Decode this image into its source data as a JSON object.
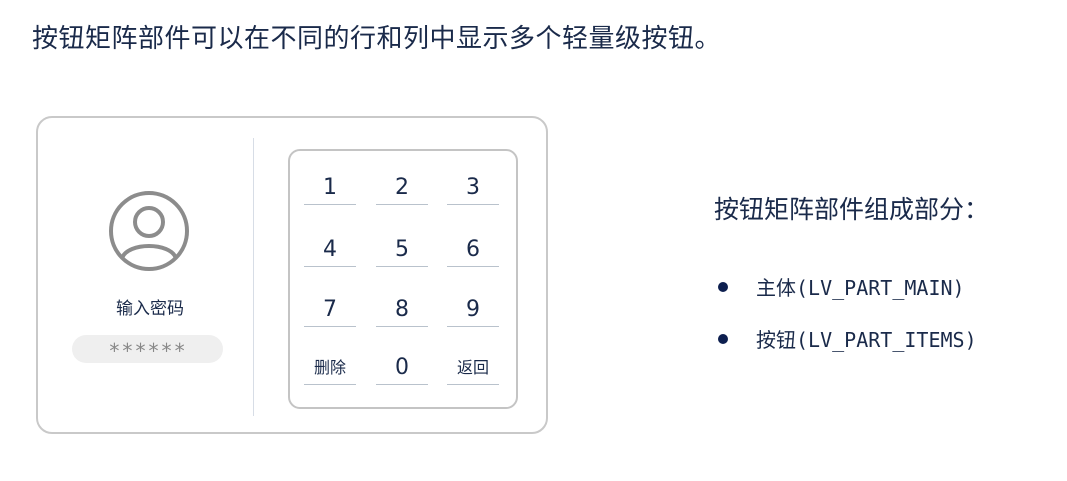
{
  "headline": "按钮矩阵部件可以在不同的行和列中显示多个轻量级按钮。",
  "demo": {
    "password_label": "输入密码",
    "password_value": "******",
    "keys": [
      "1",
      "2",
      "3",
      "4",
      "5",
      "6",
      "7",
      "8",
      "9",
      "删除",
      "0",
      "返回"
    ]
  },
  "info": {
    "title": "按钮矩阵部件组成部分：",
    "items": [
      "主体(LV_PART_MAIN)",
      "按钮(LV_PART_ITEMS)"
    ]
  },
  "colors": {
    "text": "#1a2a4a",
    "bullet": "#0d1f4f",
    "card_border": "#c9c9c9",
    "avatar": "#8c8c8c",
    "input_bg": "#efefef"
  },
  "icons": {
    "avatar": "user-circle-icon"
  }
}
